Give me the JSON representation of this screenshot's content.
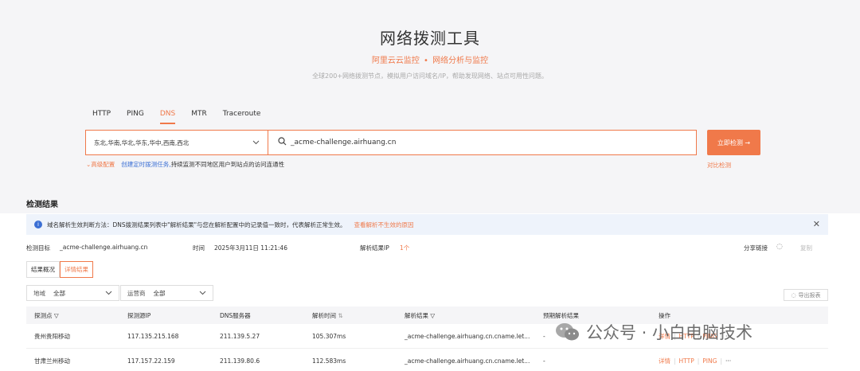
{
  "hero": {
    "title": "网络拨测工具",
    "subtitle_left": "阿里云云监控",
    "subtitle_dot": "•",
    "subtitle_right": "网络分析与监控",
    "description": "全球200+网络拨测节点，模拟用户访问域名/IP，帮助发现网络、站点可用性问题。"
  },
  "tabs": [
    {
      "label": "HTTP"
    },
    {
      "label": "PING"
    },
    {
      "label": "DNS"
    },
    {
      "label": "MTR"
    },
    {
      "label": "Traceroute"
    }
  ],
  "search": {
    "regions_value": "东北,华南,华北,华东,华中,西南,西北",
    "query_value": "_acme-challenge.airhuang.cn",
    "submit_label": "立即检测 →",
    "advanced_label": "高级配置",
    "task_link": "创建定时拨测任务,",
    "task_rest": "持续监测不同地区用户到站点的访问连通性",
    "compare_label": "对比检测"
  },
  "results": {
    "title": "检测结果",
    "alert_text": "域名解析生效判断方法：DNS拨测结果列表中\"解析结果\"与您在解析配置中的记录值一致时，代表解析正常生效。",
    "alert_link": "查看解析不生效的原因",
    "target_label": "检测目标",
    "target_value": "_acme-challenge.airhuang.cn",
    "time_label": "时间",
    "time_value": "2025年3月11日 11:21:46",
    "ip_label": "解析结果IP",
    "ip_count": "1个",
    "share_label": "分享链接",
    "copy_label": "复制",
    "view_tabs": [
      {
        "label": "结果概况"
      },
      {
        "label": "详情结果"
      }
    ],
    "filter_region_label": "地域",
    "filter_region_value": "全部",
    "filter_isp_label": "运营商",
    "filter_isp_value": "全部",
    "export_label": "导出报表"
  },
  "table": {
    "headers": [
      "探测点",
      "探测源IP",
      "DNS服务器",
      "解析时间",
      "解析结果",
      "预期解析结果",
      "操作"
    ],
    "rows": [
      {
        "node": "贵州贵阳移动",
        "src_ip": "117.135.215.168",
        "dns": "211.139.5.27",
        "time": "105.307ms",
        "result": "_acme-challenge.airhuang.cn.cname.let...",
        "expected": "-"
      },
      {
        "node": "甘肃兰州移动",
        "src_ip": "117.157.22.159",
        "dns": "211.139.80.6",
        "time": "112.583ms",
        "result": "_acme-challenge.airhuang.cn.cname.let...",
        "expected": "-"
      }
    ],
    "ops": [
      "详情",
      "HTTP",
      "PING",
      "···"
    ]
  },
  "watermark": {
    "text": "公众号 · 小白电脑技术"
  },
  "colors": {
    "accent": "#f0794a",
    "link": "#3b6fd4",
    "hero_bg": "#f5f5f7"
  }
}
